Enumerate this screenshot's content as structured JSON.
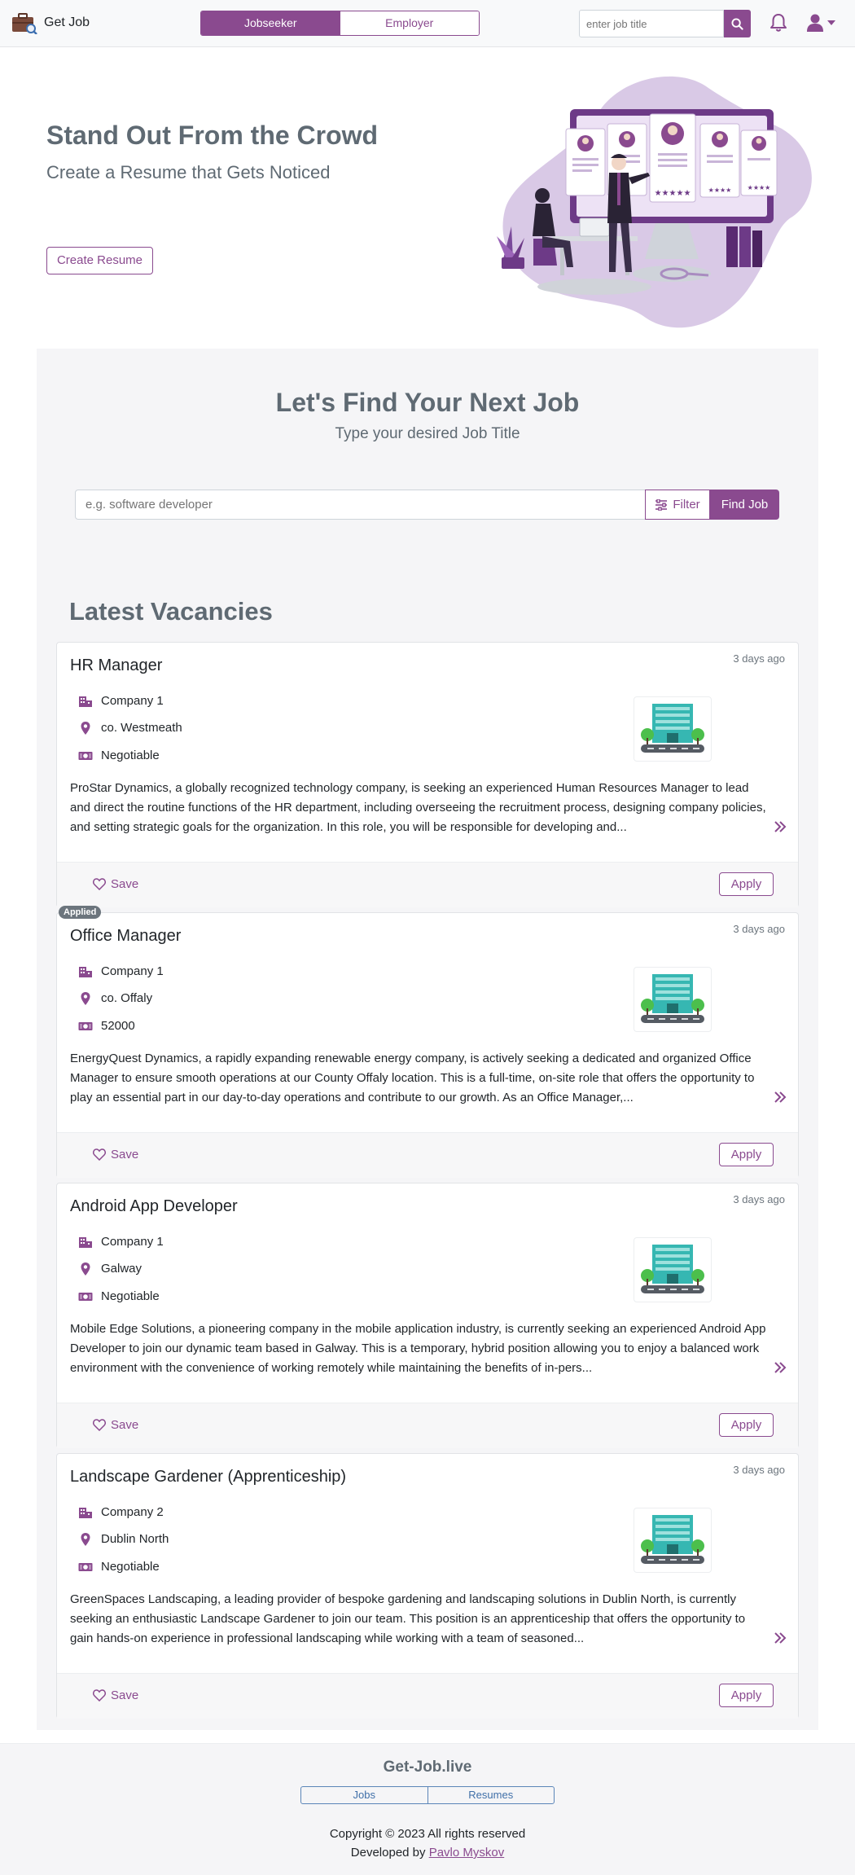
{
  "navbar": {
    "brand": "Get Job",
    "roles": [
      "Jobseeker",
      "Employer"
    ],
    "active_role": "Jobseeker",
    "search_placeholder": "enter job title",
    "brand_color": "#8a4a8f"
  },
  "hero": {
    "title": "Stand Out From the Crowd",
    "subtitle": "Create a Resume that Gets Noticed",
    "cta": "Create Resume"
  },
  "search": {
    "title": "Let's Find Your Next Job",
    "subtitle": "Type your desired Job Title",
    "placeholder": "e.g. software developer",
    "filter_label": "Filter",
    "submit_label": "Find Job"
  },
  "vacancies": {
    "heading": "Latest Vacancies",
    "save_label": "Save",
    "apply_label": "Apply",
    "jobs": [
      {
        "title": "HR Manager",
        "posted": "3 days ago",
        "company": "Company 1",
        "location": "co. Westmeath",
        "salary": "Negotiable",
        "applied": false,
        "description": "ProStar Dynamics, a globally recognized technology company, is seeking an experienced Human Resources Manager to lead and direct the routine functions of the HR department, including overseeing the recruitment process, designing company policies, and setting strategic goals for the organization. In this role, you will be responsible for developing and..."
      },
      {
        "title": "Office Manager",
        "posted": "3 days ago",
        "company": "Company 1",
        "location": "co. Offaly",
        "salary": "52000",
        "applied": true,
        "badge": "Applied",
        "description": "EnergyQuest Dynamics, a rapidly expanding renewable energy company, is actively seeking a dedicated and organized Office Manager to ensure smooth operations at our County Offaly location. This is a full-time, on-site role that offers the opportunity to play an essential part in our day-to-day operations and contribute to our growth. As an Office Manager,..."
      },
      {
        "title": "Android App Developer",
        "posted": "3 days ago",
        "company": "Company 1",
        "location": "Galway",
        "salary": "Negotiable",
        "applied": false,
        "description": "Mobile Edge Solutions, a pioneering company in the mobile application industry, is currently seeking an experienced Android App Developer to join our dynamic team based in Galway. This is a temporary, hybrid position allowing you to enjoy a balanced work environment with the convenience of working remotely while maintaining the benefits of in-pers..."
      },
      {
        "title": "Landscape Gardener (Apprenticeship)",
        "posted": "3 days ago",
        "company": "Company 2",
        "location": "Dublin North",
        "salary": "Negotiable",
        "applied": false,
        "description": "GreenSpaces Landscaping, a leading provider of bespoke gardening and landscaping solutions in Dublin North, is currently seeking an enthusiastic Landscape Gardener to join our team. This position is an apprenticeship that offers the opportunity to gain hands-on experience in professional landscaping while working with a team of seasoned..."
      }
    ]
  },
  "footer": {
    "brand": "Get-Job.live",
    "links": [
      "Jobs",
      "Resumes"
    ],
    "copyright": "Copyright © 2023 All rights reserved",
    "developed_prefix": "Developed by",
    "developer": "Pavlo Myskov"
  }
}
